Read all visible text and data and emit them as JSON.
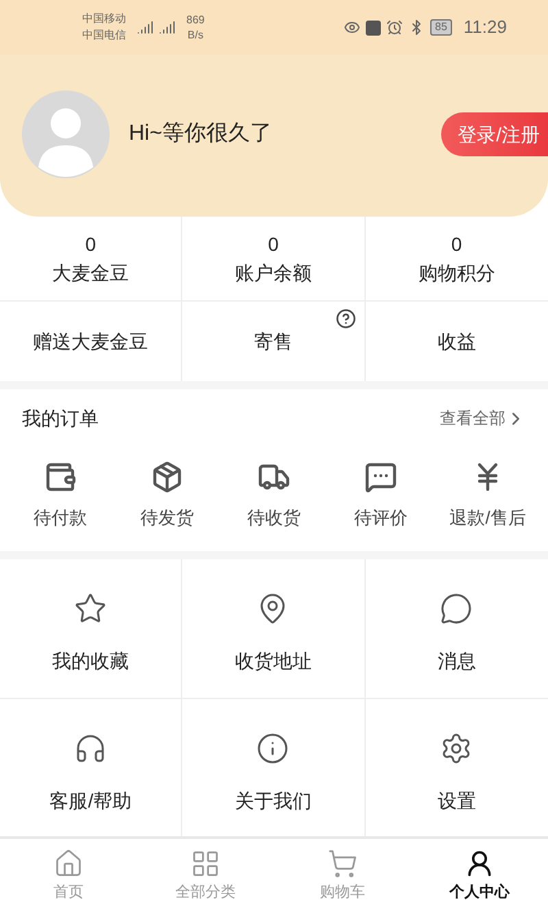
{
  "status_bar": {
    "carriers": [
      "中国移动",
      "中国电信"
    ],
    "speed": [
      "869",
      "B/s"
    ],
    "battery": "85",
    "time": "11:29"
  },
  "profile": {
    "greeting": "Hi~等你很久了",
    "login_button": "登录/注册"
  },
  "stats": [
    {
      "value": "0",
      "label": "大麦金豆"
    },
    {
      "value": "0",
      "label": "账户余额"
    },
    {
      "value": "0",
      "label": "购物积分"
    }
  ],
  "actions": [
    {
      "label": "赠送大麦金豆",
      "help": false
    },
    {
      "label": "寄售",
      "help": true
    },
    {
      "label": "收益",
      "help": false
    }
  ],
  "orders": {
    "title": "我的订单",
    "view_all": "查看全部",
    "items": [
      "待付款",
      "待发货",
      "待收货",
      "待评价",
      "退款/售后"
    ]
  },
  "services": [
    "我的收藏",
    "收货地址",
    "消息",
    "客服/帮助",
    "关于我们",
    "设置"
  ],
  "tab_bar": [
    {
      "label": "首页",
      "selected": false
    },
    {
      "label": "全部分类",
      "selected": false
    },
    {
      "label": "购物车",
      "selected": false
    },
    {
      "label": "个人中心",
      "selected": true
    }
  ]
}
